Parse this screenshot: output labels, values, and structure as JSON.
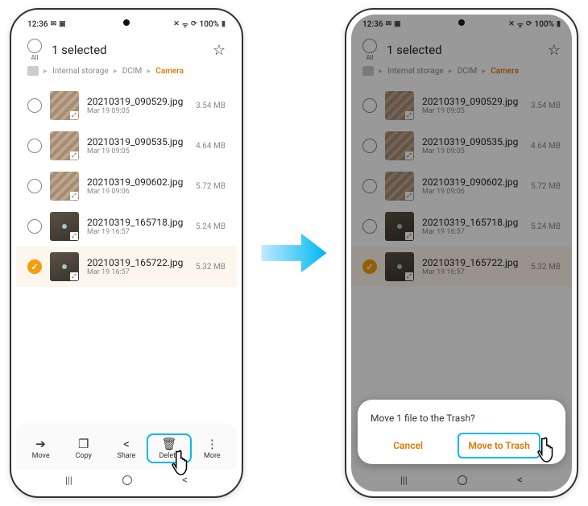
{
  "statusbar": {
    "time": "12:36",
    "battery_text": "100%"
  },
  "header": {
    "all_label": "All",
    "title": "1 selected"
  },
  "breadcrumb": {
    "items": [
      "Internal storage",
      "DCIM",
      "Camera"
    ]
  },
  "files": [
    {
      "name": "20210319_090529.jpg",
      "date": "Mar 19 09:05",
      "size": "3.54 MB",
      "selected": false,
      "thumb": "light"
    },
    {
      "name": "20210319_090535.jpg",
      "date": "Mar 19 09:05",
      "size": "4.64 MB",
      "selected": false,
      "thumb": "light"
    },
    {
      "name": "20210319_090602.jpg",
      "date": "Mar 19 09:06",
      "size": "5.72 MB",
      "selected": false,
      "thumb": "light"
    },
    {
      "name": "20210319_165718.jpg",
      "date": "Mar 19 16:57",
      "size": "5.24 MB",
      "selected": false,
      "thumb": "dark"
    },
    {
      "name": "20210319_165722.jpg",
      "date": "Mar 19 16:57",
      "size": "5.32 MB",
      "selected": true,
      "thumb": "dark"
    }
  ],
  "bottombar": {
    "move": "Move",
    "copy": "Copy",
    "share": "Share",
    "delete": "Delete",
    "more": "More"
  },
  "dialog": {
    "message": "Move 1 file to the Trash?",
    "cancel": "Cancel",
    "confirm": "Move to Trash"
  }
}
